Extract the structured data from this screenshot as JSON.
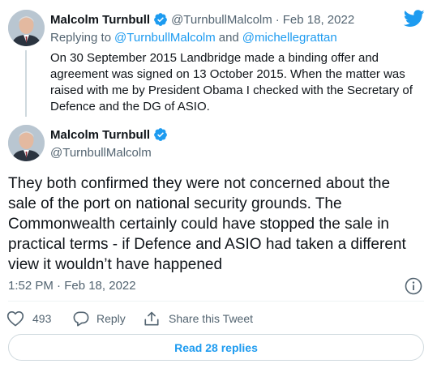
{
  "reply_tweet": {
    "author_name": "Malcolm Turnbull",
    "handle": "@TurnbullMalcolm",
    "separator": "·",
    "date": "Feb 18, 2022",
    "replying_prefix": "Replying to",
    "replying_to_1": "@TurnbullMalcolm",
    "replying_and": "and",
    "replying_to_2": "@michellegrattan",
    "text": "On 30 September 2015 Landbridge made a binding offer and agreement was signed on 13 October 2015. When the matter was raised with me by President Obama I checked with the Secretary of Defence and the DG of ASIO."
  },
  "main_tweet": {
    "author_name": "Malcolm Turnbull",
    "handle": "@TurnbullMalcolm",
    "text": "They both confirmed they were not concerned about the sale of the port on national security grounds. The Commonwealth certainly could have stopped the sale in practical terms - if Defence and ASIO had taken a different view it wouldn’t have happened",
    "timestamp": "1:52 PM · Feb 18, 2022"
  },
  "actions": {
    "like_count": "493",
    "reply_label": "Reply",
    "share_label": "Share this Tweet"
  },
  "read_replies_label": "Read 28 replies",
  "icons": {
    "brand": "twitter-bird-icon",
    "verified": "verified-badge-icon",
    "info": "info-icon",
    "like": "heart-icon",
    "reply": "reply-bubble-icon",
    "share": "share-icon"
  },
  "colors": {
    "accent": "#1d9bf0",
    "text": "#0f1419",
    "muted": "#536471",
    "border": "#cfd9de"
  }
}
